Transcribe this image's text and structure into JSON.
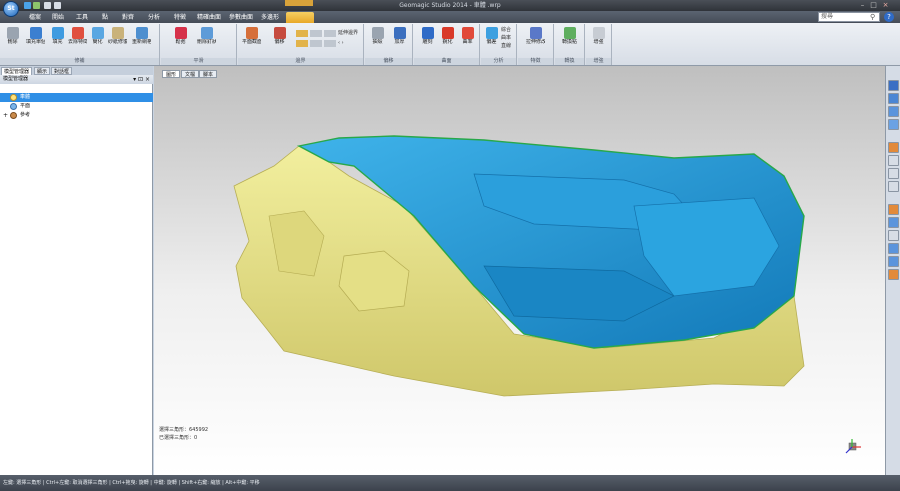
{
  "app": {
    "title": "Geomagic Studio 2014 - 車體 .wrp",
    "logo_text": "St"
  },
  "colors": {
    "ribbon_active": "#e8a829",
    "selection": "#2f8fe6",
    "model_yellow": "#e8e58a",
    "model_blue": "#1c95d4"
  },
  "tabs": [
    "檔案",
    "開始",
    "工具",
    "點",
    "對齊",
    "分析",
    "特徵",
    "精確曲面",
    "參數曲面",
    "多邊形"
  ],
  "search": {
    "placeholder": "搜尋"
  },
  "ribbon": {
    "groups": [
      {
        "label": "修補",
        "buttons": [
          "刪除",
          "填充單個孔",
          "填充",
          "去除特徵",
          "簡化",
          "砂紙修復",
          "重新網格"
        ]
      },
      {
        "label": "平滑",
        "buttons": [
          "鬆弛",
          "刪除釘狀物"
        ]
      },
      {
        "label": "邊界",
        "buttons": [
          "平面截面",
          "偏移"
        ],
        "small": [
          "延伸邊界"
        ]
      },
      {
        "label": "偏移",
        "buttons": [
          "抽殼",
          "加厚"
        ]
      },
      {
        "label": "曲面",
        "buttons": [
          "雕刻",
          "銳化",
          "曲率"
        ]
      },
      {
        "label": "分析",
        "buttons": [
          "偏差"
        ],
        "small": [
          "綜合",
          "曲率",
          "直線"
        ]
      },
      {
        "label": "特徵",
        "buttons": [
          "拉伸修改"
        ]
      },
      {
        "label": "轉換",
        "buttons": [
          "轉換點"
        ]
      },
      {
        "label": "增強",
        "buttons": [
          "增強"
        ]
      }
    ]
  },
  "left_panel": {
    "tabs": [
      "模型管理器",
      "顯示",
      "對話框"
    ],
    "header": "模型管理器",
    "tree": [
      {
        "label": "車體",
        "selected": true
      },
      {
        "label": "平面",
        "selected": false
      },
      {
        "label": "參考",
        "selected": false,
        "expander": "+"
      }
    ]
  },
  "viewport": {
    "tabs": [
      "圖形",
      "文檔",
      "腳本"
    ],
    "info_lines": [
      "選擇三角形：645992",
      "已選擇三角形：0"
    ]
  },
  "statusbar": {
    "text": "左鍵: 選擇三角形 | Ctrl+左鍵: 取消選擇三角形 | Ctrl+拖曳: 旋轉 | 中鍵: 旋轉 | Shift+右鍵: 縮放 | Alt+中鍵: 平移"
  }
}
